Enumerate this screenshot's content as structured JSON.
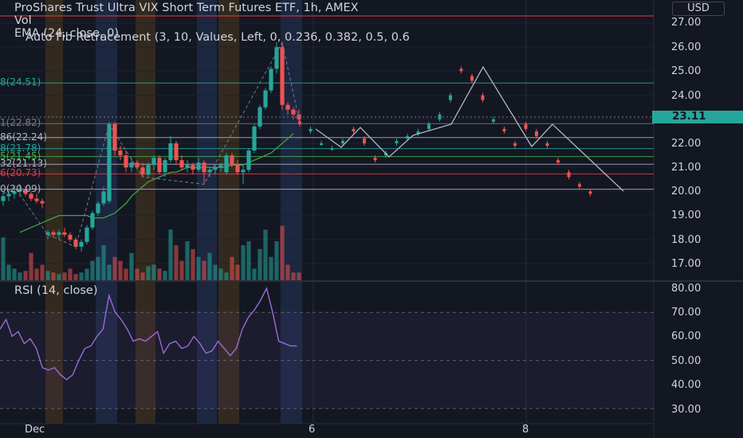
{
  "window": {
    "title": "ProShares Trust Ultra VIX Short Term Futures ETF, 1h, AMEX"
  },
  "legend": {
    "volume": "Vol",
    "ema": "EMA (24, close, 0)",
    "fib": "Auto Fib Retracement (3, 10, Values, Left, 0, 0.236, 0.382, 0.5, 0.6",
    "rsi": "RSI (14, close)"
  },
  "price_axis": {
    "currency": "USD",
    "current_price": "23.11",
    "ticks": [
      "27.00",
      "26.00",
      "25.00",
      "24.00",
      "22.00",
      "21.00",
      "20.00",
      "19.00",
      "18.00",
      "17.00"
    ]
  },
  "rsi_axis": {
    "ticks": [
      "80.00",
      "70.00",
      "60.00",
      "50.00",
      "40.00",
      "30.00"
    ]
  },
  "time_axis": {
    "ticks": [
      "Dec",
      "6",
      "8"
    ]
  },
  "fib_labels": [
    {
      "text": "8(24.51)",
      "color": "#22ab94"
    },
    {
      "text": "1(22.82)",
      "color": "#787b86"
    },
    {
      "text": "86(22.24)",
      "color": "#b2b5be"
    },
    {
      "text": "8(21.78)",
      "color": "#26a69a"
    },
    {
      "text": "5(21.45)",
      "color": "#4caf50"
    },
    {
      "text": "32(21.13)",
      "color": "#b2b5be"
    },
    {
      "text": "6(20.73)",
      "color": "#f23645"
    },
    {
      "text": "0(20.09)",
      "color": "#b2b5be"
    }
  ],
  "colors": {
    "background": "#131722",
    "up": "#26a69a",
    "down": "#ef5350",
    "ema": "#43a047",
    "rsi": "#9c6ad5",
    "zigzag": "#b2b5be"
  },
  "chart_data": {
    "type": "candlestick",
    "title": "ProShares Trust Ultra VIX Short Term Futures ETF, 1h, AMEX",
    "y_range": [
      16.5,
      27.3
    ],
    "rsi_range": [
      27,
      83
    ],
    "candles": [
      {
        "o": 19.6,
        "h": 20.0,
        "l": 19.4,
        "c": 19.8
      },
      {
        "o": 19.8,
        "h": 20.1,
        "l": 19.6,
        "c": 19.9
      },
      {
        "o": 19.9,
        "h": 20.2,
        "l": 19.7,
        "c": 20.0
      },
      {
        "o": 20.0,
        "h": 20.3,
        "l": 19.8,
        "c": 20.1
      },
      {
        "o": 20.1,
        "h": 20.2,
        "l": 19.8,
        "c": 19.9
      },
      {
        "o": 19.9,
        "h": 20.0,
        "l": 19.6,
        "c": 19.7
      },
      {
        "o": 19.7,
        "h": 19.9,
        "l": 19.5,
        "c": 19.6
      },
      {
        "o": 19.6,
        "h": 19.7,
        "l": 19.3,
        "c": 19.5
      },
      {
        "o": 18.2,
        "h": 18.4,
        "l": 18.0,
        "c": 18.3
      },
      {
        "o": 18.3,
        "h": 18.4,
        "l": 18.1,
        "c": 18.2
      },
      {
        "o": 18.2,
        "h": 18.4,
        "l": 18.0,
        "c": 18.3
      },
      {
        "o": 18.3,
        "h": 18.5,
        "l": 18.1,
        "c": 18.2
      },
      {
        "o": 18.2,
        "h": 18.3,
        "l": 17.9,
        "c": 18.0
      },
      {
        "o": 18.0,
        "h": 18.1,
        "l": 17.6,
        "c": 17.7
      },
      {
        "o": 17.7,
        "h": 18.0,
        "l": 17.5,
        "c": 17.9
      },
      {
        "o": 17.9,
        "h": 18.6,
        "l": 17.8,
        "c": 18.5
      },
      {
        "o": 18.5,
        "h": 19.2,
        "l": 18.4,
        "c": 19.1
      },
      {
        "o": 19.1,
        "h": 19.6,
        "l": 19.0,
        "c": 19.5
      },
      {
        "o": 19.5,
        "h": 20.2,
        "l": 19.4,
        "c": 20.0
      },
      {
        "o": 19.6,
        "h": 22.9,
        "l": 19.5,
        "c": 22.8
      },
      {
        "o": 22.8,
        "h": 22.9,
        "l": 21.5,
        "c": 21.7
      },
      {
        "o": 21.7,
        "h": 21.9,
        "l": 21.3,
        "c": 21.5
      },
      {
        "o": 21.5,
        "h": 21.7,
        "l": 20.8,
        "c": 21.0
      },
      {
        "o": 21.0,
        "h": 21.4,
        "l": 20.8,
        "c": 21.2
      },
      {
        "o": 21.2,
        "h": 21.3,
        "l": 20.9,
        "c": 21.0
      },
      {
        "o": 21.0,
        "h": 21.2,
        "l": 20.6,
        "c": 20.7
      },
      {
        "o": 20.7,
        "h": 21.2,
        "l": 20.6,
        "c": 21.1
      },
      {
        "o": 21.1,
        "h": 21.5,
        "l": 20.9,
        "c": 21.4
      },
      {
        "o": 21.4,
        "h": 21.5,
        "l": 20.7,
        "c": 20.8
      },
      {
        "o": 20.8,
        "h": 21.4,
        "l": 20.6,
        "c": 21.3
      },
      {
        "o": 21.3,
        "h": 22.3,
        "l": 21.2,
        "c": 22.0
      },
      {
        "o": 22.0,
        "h": 22.1,
        "l": 21.1,
        "c": 21.3
      },
      {
        "o": 21.3,
        "h": 21.5,
        "l": 20.9,
        "c": 21.0
      },
      {
        "o": 21.0,
        "h": 21.3,
        "l": 20.8,
        "c": 21.1
      },
      {
        "o": 21.1,
        "h": 21.2,
        "l": 20.7,
        "c": 20.9
      },
      {
        "o": 20.9,
        "h": 21.4,
        "l": 20.8,
        "c": 21.2
      },
      {
        "o": 21.2,
        "h": 21.3,
        "l": 20.3,
        "c": 20.8
      },
      {
        "o": 20.8,
        "h": 21.0,
        "l": 20.6,
        "c": 20.9
      },
      {
        "o": 20.9,
        "h": 21.1,
        "l": 20.7,
        "c": 21.0
      },
      {
        "o": 21.0,
        "h": 21.2,
        "l": 20.8,
        "c": 21.1
      },
      {
        "o": 20.8,
        "h": 21.6,
        "l": 20.7,
        "c": 21.5
      },
      {
        "o": 21.5,
        "h": 21.6,
        "l": 21.0,
        "c": 21.1
      },
      {
        "o": 21.1,
        "h": 21.3,
        "l": 20.7,
        "c": 20.8
      },
      {
        "o": 20.8,
        "h": 21.1,
        "l": 20.3,
        "c": 20.9
      },
      {
        "o": 20.9,
        "h": 21.8,
        "l": 20.8,
        "c": 21.7
      },
      {
        "o": 21.7,
        "h": 22.8,
        "l": 21.6,
        "c": 22.7
      },
      {
        "o": 22.7,
        "h": 23.6,
        "l": 22.6,
        "c": 23.5
      },
      {
        "o": 23.5,
        "h": 24.3,
        "l": 23.4,
        "c": 24.2
      },
      {
        "o": 24.2,
        "h": 25.2,
        "l": 24.1,
        "c": 25.1
      },
      {
        "o": 25.1,
        "h": 26.2,
        "l": 24.9,
        "c": 26.0
      },
      {
        "o": 26.0,
        "h": 26.2,
        "l": 23.4,
        "c": 23.6
      },
      {
        "o": 23.6,
        "h": 23.7,
        "l": 23.2,
        "c": 23.4
      },
      {
        "o": 23.4,
        "h": 23.5,
        "l": 23.0,
        "c": 23.2
      },
      {
        "o": 23.2,
        "h": 23.4,
        "l": 22.8,
        "c": 23.0
      }
    ],
    "volume": [
      0.55,
      0.2,
      0.15,
      0.1,
      0.12,
      0.35,
      0.15,
      0.2,
      0.12,
      0.1,
      0.08,
      0.1,
      0.15,
      0.08,
      0.1,
      0.15,
      0.25,
      0.3,
      0.45,
      0.2,
      0.3,
      0.25,
      0.15,
      0.35,
      0.15,
      0.1,
      0.18,
      0.2,
      0.15,
      0.12,
      0.65,
      0.45,
      0.25,
      0.5,
      0.4,
      0.3,
      0.25,
      0.35,
      0.2,
      0.15,
      0.1,
      0.3,
      0.2,
      0.45,
      0.5,
      0.15,
      0.4,
      0.65,
      0.3,
      0.5,
      0.7,
      0.2,
      0.1,
      0.1
    ],
    "ema": [
      18.3,
      18.4,
      18.5,
      18.6,
      18.7,
      18.8,
      18.9,
      19.0,
      19.0,
      19.0,
      19.0,
      19.0,
      19.0,
      18.9,
      18.9,
      18.9,
      19.0,
      19.1,
      19.3,
      19.5,
      19.8,
      20.0,
      20.2,
      20.4,
      20.5,
      20.6,
      20.7,
      20.8,
      20.8,
      20.9,
      21.0,
      21.0,
      21.0,
      21.0,
      21.0,
      21.0,
      21.0,
      21.0,
      21.1,
      21.1,
      21.1,
      21.2,
      21.3,
      21.4,
      21.5,
      21.6,
      21.8,
      22.0,
      22.2,
      22.4
    ],
    "rsi": [
      63,
      67,
      60,
      62,
      57,
      59,
      55,
      47,
      46,
      47,
      44,
      42,
      44,
      50,
      55,
      56,
      60,
      63,
      77,
      70,
      67,
      63,
      58,
      59,
      58,
      60,
      62,
      53,
      57,
      58,
      55,
      56,
      60,
      57,
      53,
      54,
      58,
      55,
      52,
      55,
      63,
      68,
      71,
      75,
      80,
      70,
      58,
      57,
      56,
      56
    ],
    "zigzag": [
      [
        0,
        19.9
      ],
      [
        2,
        20.2
      ],
      [
        8,
        18.2
      ],
      [
        13,
        17.7
      ],
      [
        19,
        22.8
      ],
      [
        25,
        20.6
      ],
      [
        36,
        20.3
      ],
      [
        50,
        26.2
      ],
      [
        53,
        23.0
      ]
    ],
    "fib_levels": [
      24.51,
      22.82,
      22.24,
      21.78,
      21.45,
      21.13,
      20.73,
      20.09
    ],
    "continuation": [
      [
        22.9,
        22.8
      ],
      [
        22.5,
        22.6
      ],
      [
        22.0,
        22.0
      ],
      [
        21.8,
        21.8
      ],
      [
        22.0,
        22.1
      ],
      [
        22.6,
        22.5
      ],
      [
        22.2,
        22.0
      ],
      [
        21.4,
        21.3
      ],
      [
        21.5,
        21.6
      ],
      [
        22.0,
        22.1
      ],
      [
        22.2,
        22.3
      ],
      [
        22.4,
        22.5
      ],
      [
        22.6,
        22.8
      ],
      [
        23.0,
        23.2
      ],
      [
        23.8,
        24.0
      ],
      [
        25.1,
        25.0
      ],
      [
        24.8,
        24.6
      ],
      [
        24.0,
        23.8
      ],
      [
        22.9,
        23.0
      ],
      [
        22.6,
        22.5
      ],
      [
        22.0,
        21.9
      ],
      [
        22.8,
        22.6
      ],
      [
        22.5,
        22.3
      ],
      [
        22.0,
        21.9
      ],
      [
        21.3,
        21.2
      ],
      [
        20.8,
        20.6
      ],
      [
        20.3,
        20.2
      ],
      [
        20.0,
        19.9
      ]
    ],
    "projection_path": [
      [
        396,
        162
      ],
      [
        428,
        185
      ],
      [
        452,
        160
      ],
      [
        488,
        197
      ],
      [
        518,
        170
      ],
      [
        566,
        156
      ],
      [
        606,
        84
      ],
      [
        667,
        184
      ],
      [
        693,
        156
      ],
      [
        782,
        240
      ]
    ]
  }
}
